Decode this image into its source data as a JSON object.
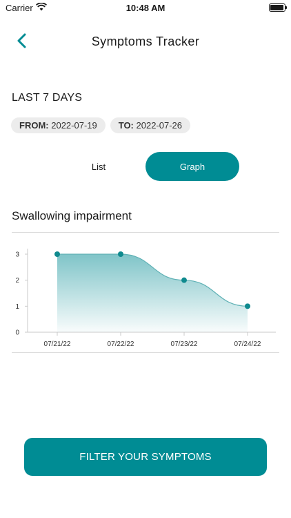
{
  "status": {
    "carrier": "Carrier",
    "time": "10:48 AM"
  },
  "header": {
    "title": "Symptoms Tracker",
    "back_icon": "chevron-left-icon"
  },
  "period": {
    "title": "LAST 7 DAYS",
    "from_label": "FROM:",
    "from_value": "2022-07-19",
    "to_label": "TO:",
    "to_value": "2022-07-26"
  },
  "view_toggle": {
    "list_label": "List",
    "graph_label": "Graph",
    "selected": "Graph"
  },
  "symptom": {
    "name": "Swallowing impairment"
  },
  "colors": {
    "accent": "#008c94",
    "point": "#0f8a8e",
    "area_top": "#7fc4c8",
    "chip_bg": "#ececec"
  },
  "chart_data": {
    "type": "area",
    "categories": [
      "07/21/22",
      "07/22/22",
      "07/23/22",
      "07/24/22"
    ],
    "values": [
      3,
      3,
      2,
      1
    ],
    "ylim": [
      0,
      3
    ],
    "yticks": [
      0,
      1,
      2,
      3
    ],
    "title": "",
    "xlabel": "",
    "ylabel": "",
    "grid": false
  },
  "footer": {
    "button_label": "FILTER YOUR SYMPTOMS"
  }
}
